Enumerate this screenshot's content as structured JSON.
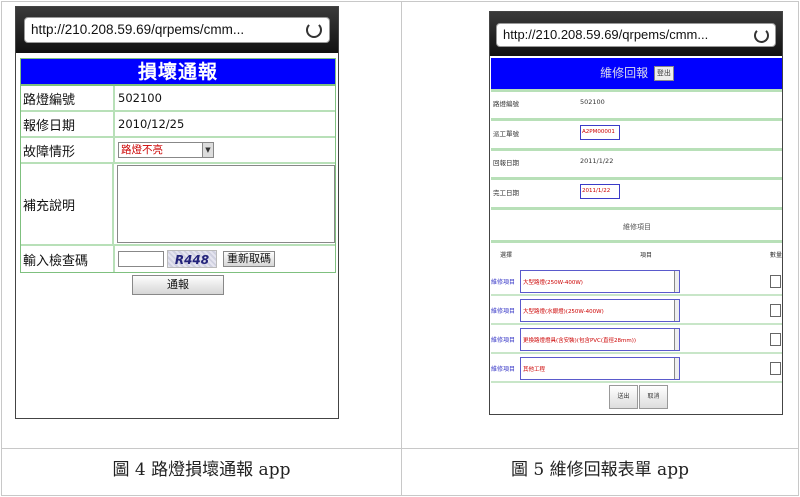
{
  "phone1": {
    "url": "http://210.208.59.69/qrpems/cmm...",
    "title": "損壞通報",
    "rows": {
      "lamp_id": {
        "label": "路燈編號",
        "value": "502100"
      },
      "report_date": {
        "label": "報修日期",
        "value": "2010/12/25"
      },
      "fault": {
        "label": "故障情形",
        "value": "路燈不亮"
      },
      "note": {
        "label": "補充說明"
      },
      "captcha": {
        "label": "輸入檢查碼",
        "code": "R448",
        "refresh_label": "重新取碼"
      }
    },
    "submit_label": "通報"
  },
  "phone2": {
    "url": "http://210.208.59.69/qrpems/cmm...",
    "title": "維修回報",
    "title_tag": "登出",
    "rows": [
      {
        "label": "路燈編號",
        "value": "502100"
      },
      {
        "label": "派工單號",
        "value": "A2PM00001"
      },
      {
        "label": "回報日期",
        "value": "2011/1/22"
      },
      {
        "label": "完工日期",
        "value": "2011/1/22"
      }
    ],
    "section_title": "維修項目",
    "headers": {
      "col1": "選擇",
      "col2": "項目",
      "col3": "數量"
    },
    "items": [
      {
        "tag": "維修項目",
        "text": "大型路燈(250W-400W)"
      },
      {
        "tag": "維修項目",
        "text": "大型路燈(水銀燈)(250W-400W)"
      },
      {
        "tag": "維修項目",
        "text": "更換路燈燈具(含安裝)(包含PVC(直徑28mm))"
      },
      {
        "tag": "維修項目",
        "text": "其他工程"
      }
    ],
    "buttons": {
      "submit": "送出",
      "cancel": "取消"
    }
  },
  "captions": {
    "left": "圖 4 路燈損壞通報 app",
    "right": "圖 5 維修回報表單 app"
  }
}
